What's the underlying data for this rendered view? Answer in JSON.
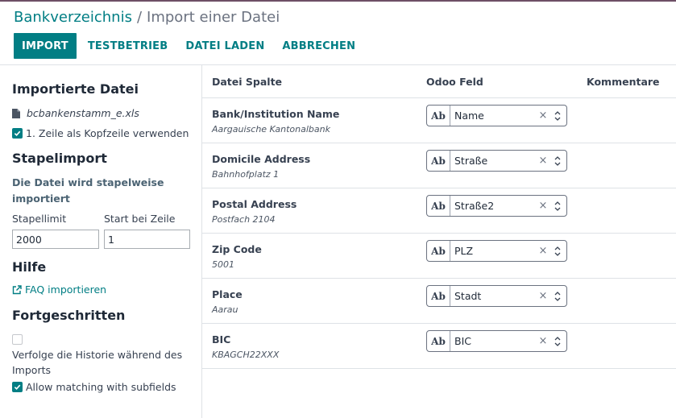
{
  "breadcrumb": {
    "parent": "Bankverzeichnis",
    "separator": "/",
    "current": "Import einer Datei"
  },
  "toolbar": {
    "import": "IMPORT",
    "test": "TESTBETRIEB",
    "load": "DATEI LADEN",
    "cancel": "ABBRECHEN"
  },
  "sidebar": {
    "imported_file_title": "Importierte Datei",
    "file_name": "bcbankenstamm_e.xls",
    "header_row_label": "1. Zeile als Kopfzeile verwenden",
    "header_row_checked": true,
    "batch_title": "Stapelimport",
    "batch_info": "Die Datei wird stapelweise importiert",
    "batch_limit_label": "Stapellimit",
    "batch_limit_value": "2000",
    "start_row_label": "Start bei Zeile",
    "start_row_value": "1",
    "help_title": "Hilfe",
    "faq_link": "FAQ importieren",
    "advanced_title": "Fortgeschritten",
    "track_history_label": "Verfolge die Historie während des Imports",
    "track_history_checked": false,
    "subfields_label": "Allow matching with subfields",
    "subfields_checked": true
  },
  "table": {
    "headers": {
      "column": "Datei Spalte",
      "field": "Odoo Feld",
      "comments": "Kommentare"
    },
    "type_badge": "Ab",
    "rows": [
      {
        "name": "Bank/Institution Name",
        "sample": "Aargauische Kantonalbank",
        "field": "Name"
      },
      {
        "name": "Domicile Address",
        "sample": "Bahnhofplatz 1",
        "field": "Straße"
      },
      {
        "name": "Postal Address",
        "sample": "Postfach 2104",
        "field": "Straße2"
      },
      {
        "name": "Zip Code",
        "sample": "5001",
        "field": "PLZ"
      },
      {
        "name": "Place",
        "sample": "Aarau",
        "field": "Stadt"
      },
      {
        "name": "BIC",
        "sample": "KBAGCH22XXX",
        "field": "BIC"
      }
    ]
  },
  "colors": {
    "accent": "#017e84",
    "topbar": "#6d4f66"
  },
  "icons": {
    "file": "file-icon",
    "external_link": "external-link-icon",
    "checkbox_check": "check-icon",
    "clear": "clear-icon",
    "dropdown": "updown-arrows-icon"
  }
}
